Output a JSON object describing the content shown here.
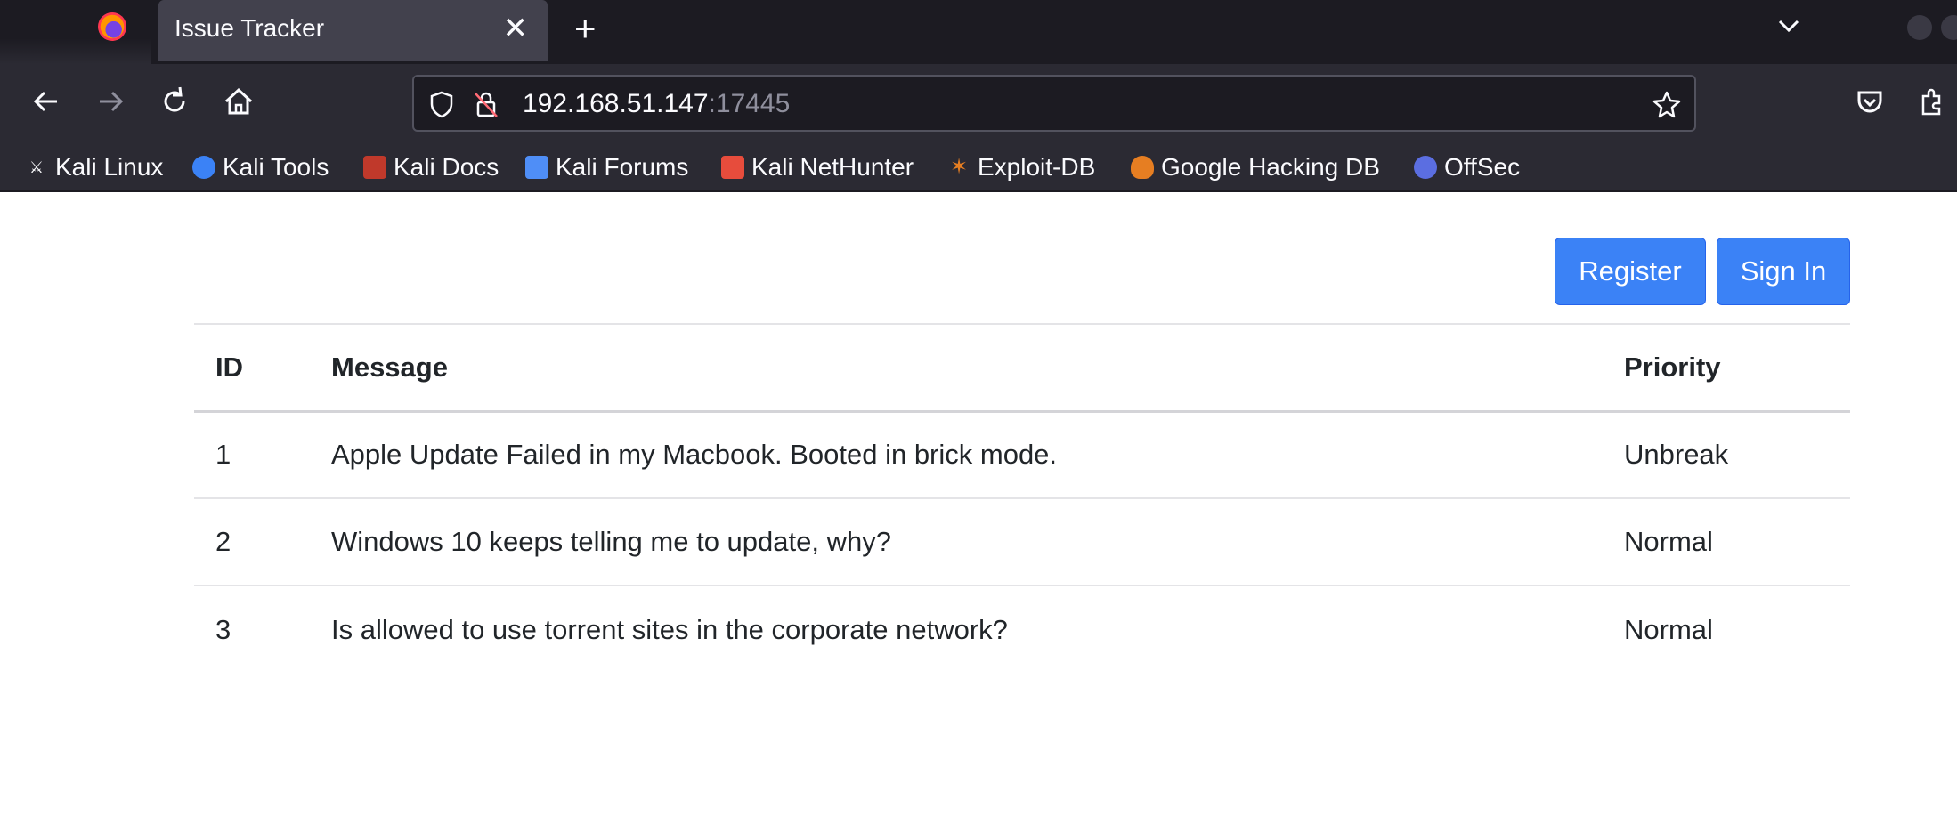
{
  "browser": {
    "tab_title": "Issue Tracker",
    "tab_close": "✕",
    "new_tab": "+",
    "url_host": "192.168.51.147",
    "url_port": ":17445",
    "bookmarks": [
      {
        "label": "Kali Linux",
        "icon": "kali-dragon-icon",
        "color": "#1c1b22"
      },
      {
        "label": "Kali Tools",
        "icon": "kali-tools-icon",
        "color": "#3b82f6"
      },
      {
        "label": "Kali Docs",
        "icon": "kali-docs-icon",
        "color": "#c0392b"
      },
      {
        "label": "Kali Forums",
        "icon": "kali-forums-icon",
        "color": "#4f8ef7"
      },
      {
        "label": "Kali NetHunter",
        "icon": "kali-nethunter-icon",
        "color": "#e74c3c"
      },
      {
        "label": "Exploit-DB",
        "icon": "exploit-db-icon",
        "color": "#e67e22"
      },
      {
        "label": "Google Hacking DB",
        "icon": "ghdb-icon",
        "color": "#e67e22"
      },
      {
        "label": "OffSec",
        "icon": "offsec-icon",
        "color": "#5b6ee1"
      }
    ]
  },
  "page": {
    "register_label": "Register",
    "signin_label": "Sign In",
    "accent_color": "#3b82f6",
    "table": {
      "headers": [
        "ID",
        "Message",
        "Priority"
      ],
      "rows": [
        {
          "id": "1",
          "message": "Apple Update Failed in my Macbook. Booted in brick mode.",
          "priority": "Unbreak"
        },
        {
          "id": "2",
          "message": "Windows 10 keeps telling me to update, why?",
          "priority": "Normal"
        },
        {
          "id": "3",
          "message": "Is allowed to use torrent sites in the corporate network?",
          "priority": "Normal"
        }
      ]
    }
  }
}
